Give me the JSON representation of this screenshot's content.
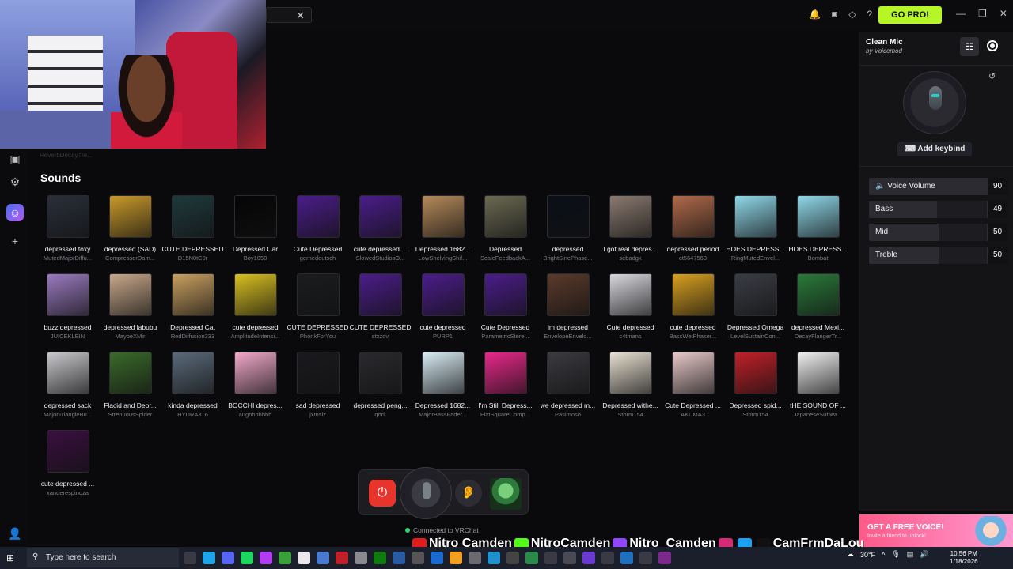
{
  "topbar": {
    "go_pro_label": "GO PRO!",
    "icons": [
      "bell-icon",
      "discord-icon",
      "diamond-icon",
      "help-icon"
    ],
    "window_controls": [
      "minimize-icon",
      "restore-icon",
      "close-icon"
    ]
  },
  "rail": {
    "items": [
      "soundboard-icon",
      "settings-icon",
      "voices-icon",
      "add-icon",
      "profile-icon"
    ]
  },
  "faded_label": "ReverbDecayTre...",
  "sounds": {
    "title": "Sounds",
    "items": [
      {
        "name": "depressed foxy",
        "author": "MutedMajorDiffu...",
        "color": "#2a2f3a"
      },
      {
        "name": "depressed (SAD)",
        "author": "CompressorDam...",
        "color": "#c99a2a"
      },
      {
        "name": "CUTE DEPRESSED",
        "author": "D15N0tC0r",
        "color": "#1f3a3d"
      },
      {
        "name": "Depressed Car",
        "author": "Boy1058",
        "color": "#050505"
      },
      {
        "name": "Cute Depressed",
        "author": "gernedeutsch",
        "color": "#4b1d8a"
      },
      {
        "name": "cute depressed ...",
        "author": "SlowedStudiosO...",
        "color": "#4b1d8a"
      },
      {
        "name": "Depressed 1682...",
        "author": "LowShelvingShif...",
        "color": "#b58a5a"
      },
      {
        "name": "Depressed",
        "author": "ScaleFeedbackA...",
        "color": "#6b6a52"
      },
      {
        "name": "depressed",
        "author": "BrightSinePhase...",
        "color": "#0a0f18"
      },
      {
        "name": "I got real depres...",
        "author": "sebadgk",
        "color": "#8a7a70"
      },
      {
        "name": "depressed period",
        "author": "ct5647563",
        "color": "#b06a4a"
      },
      {
        "name": "HOES DEPRESS...",
        "author": "RingMutedEnvel...",
        "color": "#8fd8e8"
      },
      {
        "name": "HOES DEPRESS...",
        "author": "Bombat",
        "color": "#8fd8e8"
      },
      {
        "name": "buzz depressed",
        "author": "JUICEKLEIN",
        "color": "#9a7ac0"
      },
      {
        "name": "depressed labubu",
        "author": "MaybeXMir",
        "color": "#c8a88a"
      },
      {
        "name": "Depressed Cat",
        "author": "RedDiffusion333",
        "color": "#c9a060"
      },
      {
        "name": "cute depressed",
        "author": "AmplitudeIntensi...",
        "color": "#d8c020"
      },
      {
        "name": "CUTE DEPRESSED",
        "author": "PhonkForYou",
        "color": "#1a1c1e"
      },
      {
        "name": "CUTE DEPRESSED",
        "author": "stxzqv",
        "color": "#4b1d8a"
      },
      {
        "name": "cute depressed",
        "author": "PURP1",
        "color": "#4b1d8a"
      },
      {
        "name": "Cute Depressed",
        "author": "ParametricStere...",
        "color": "#4b1d8a"
      },
      {
        "name": "im depressed",
        "author": "EnvelopeEnvelo...",
        "color": "#5a3a2a"
      },
      {
        "name": "Cute depressed",
        "author": "c4tmans",
        "color": "#d8d8de"
      },
      {
        "name": "cute depressed",
        "author": "BassWetPhaser...",
        "color": "#d8a020"
      },
      {
        "name": "Depressed Omega",
        "author": "LevelSustainCon...",
        "color": "#3a3d44"
      },
      {
        "name": "depressed Mexi...",
        "author": "DecayFlangerTr...",
        "color": "#2a7a3a"
      },
      {
        "name": "depressed sack",
        "author": "MajorTriangleBu...",
        "color": "#c8c8cc"
      },
      {
        "name": "Flacid and Depr...",
        "author": "StrenuousSpider",
        "color": "#3a6a2a"
      },
      {
        "name": "kinda depressed",
        "author": "HYDRA316",
        "color": "#5a6a7a"
      },
      {
        "name": "BOCCHI depres...",
        "author": "aughhhhhhh",
        "color": "#f0a8c8"
      },
      {
        "name": "sad depressed",
        "author": "jxmslz",
        "color": "#1a1a1e"
      },
      {
        "name": "depressed peng...",
        "author": "qorii",
        "color": "#2a2a2e"
      },
      {
        "name": "Depressed 1682...",
        "author": "MajorBassFader...",
        "color": "#d8ecf4"
      },
      {
        "name": "I'm Still Depress...",
        "author": "FlatSquareComp...",
        "color": "#e8288a"
      },
      {
        "name": "we depressed m...",
        "author": "Pasimoso",
        "color": "#3a3a40"
      },
      {
        "name": "Depressed withe...",
        "author": "Storm154",
        "color": "#e8e0d0"
      },
      {
        "name": "Cute Depressed ...",
        "author": "AKUMA3",
        "color": "#e8c8c8"
      },
      {
        "name": "Depressed spid...",
        "author": "Storm154",
        "color": "#c02028"
      },
      {
        "name": "tHE SOUND OF ...",
        "author": "JapaneseSubwa...",
        "color": "#f0f0f0"
      },
      {
        "name": "cute depressed ...",
        "author": "xanderespinoza",
        "color": "#3a1040"
      }
    ]
  },
  "dock": {
    "status": "Connected to VRChat"
  },
  "panel": {
    "voice_name": "Clean Mic",
    "voice_by": "by Voicemod",
    "keybind_label": "Add keybind",
    "sliders": [
      {
        "label": "Voice Volume",
        "value": "90",
        "level": 0.9
      },
      {
        "label": "Bass",
        "value": "49",
        "level": 0.49
      },
      {
        "label": "Mid",
        "value": "50",
        "level": 0.5
      },
      {
        "label": "Treble",
        "value": "50",
        "level": 0.5
      }
    ]
  },
  "promo": {
    "title": "GET A FREE VOICE!",
    "subtitle": "Invite a friend to unlock!"
  },
  "social": {
    "youtube": "Nitro Camden",
    "kick": "NitroCamden",
    "twitch": "Nitro_Camden",
    "instagram_tiktok": "CamFrmDaLou"
  },
  "taskbar": {
    "search_placeholder": "Type here to search",
    "temperature": "30°F",
    "time": "10:56 PM",
    "date": "1/18/2026"
  }
}
